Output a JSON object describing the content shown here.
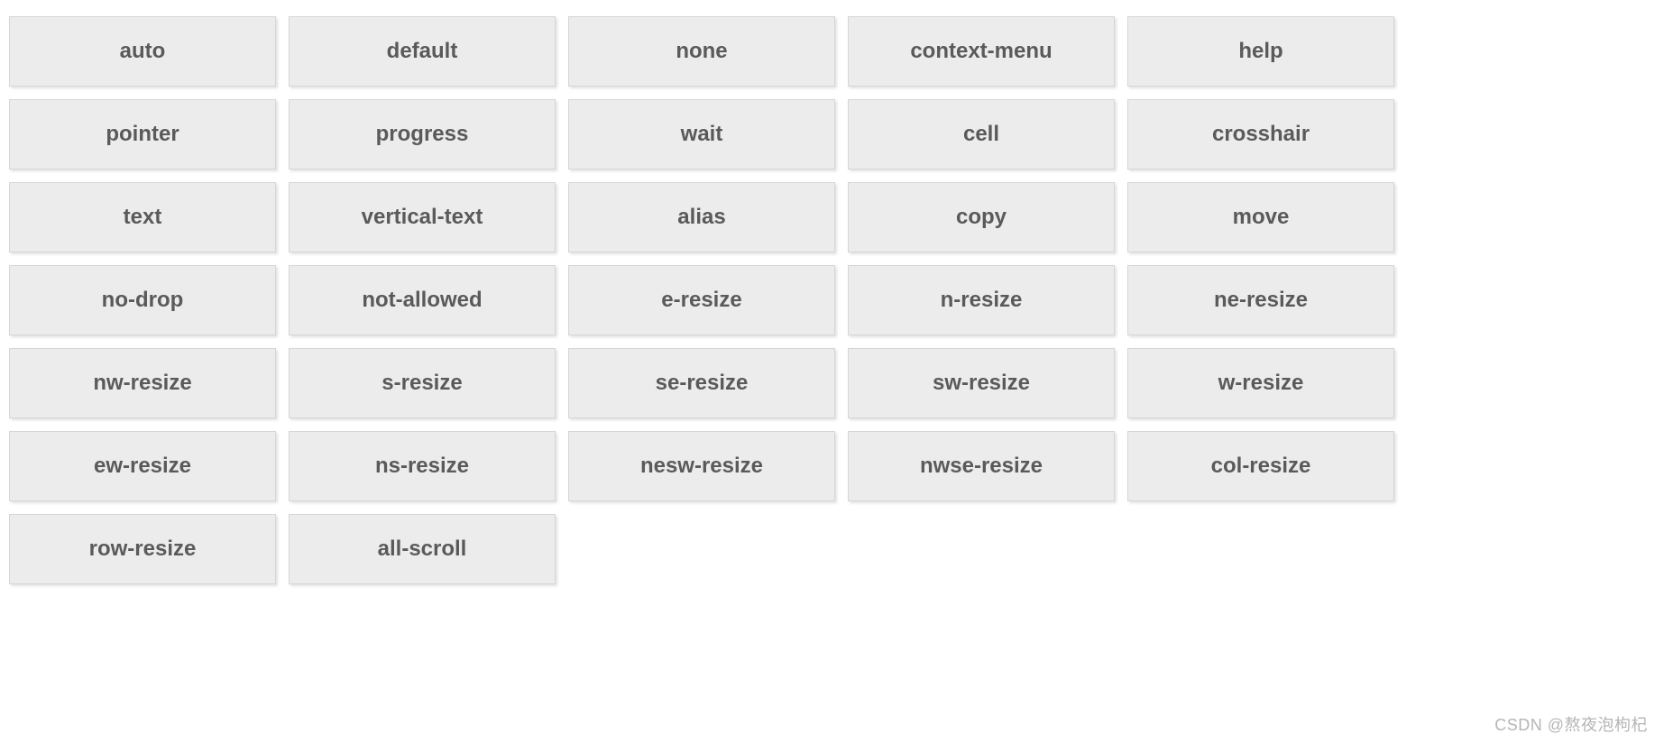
{
  "cursors": [
    "auto",
    "default",
    "none",
    "context-menu",
    "help",
    "pointer",
    "progress",
    "wait",
    "cell",
    "crosshair",
    "text",
    "vertical-text",
    "alias",
    "copy",
    "move",
    "no-drop",
    "not-allowed",
    "e-resize",
    "n-resize",
    "ne-resize",
    "nw-resize",
    "s-resize",
    "se-resize",
    "sw-resize",
    "w-resize",
    "ew-resize",
    "ns-resize",
    "nesw-resize",
    "nwse-resize",
    "col-resize",
    "row-resize",
    "all-scroll"
  ],
  "watermark": "CSDN @熬夜泡枸杞"
}
